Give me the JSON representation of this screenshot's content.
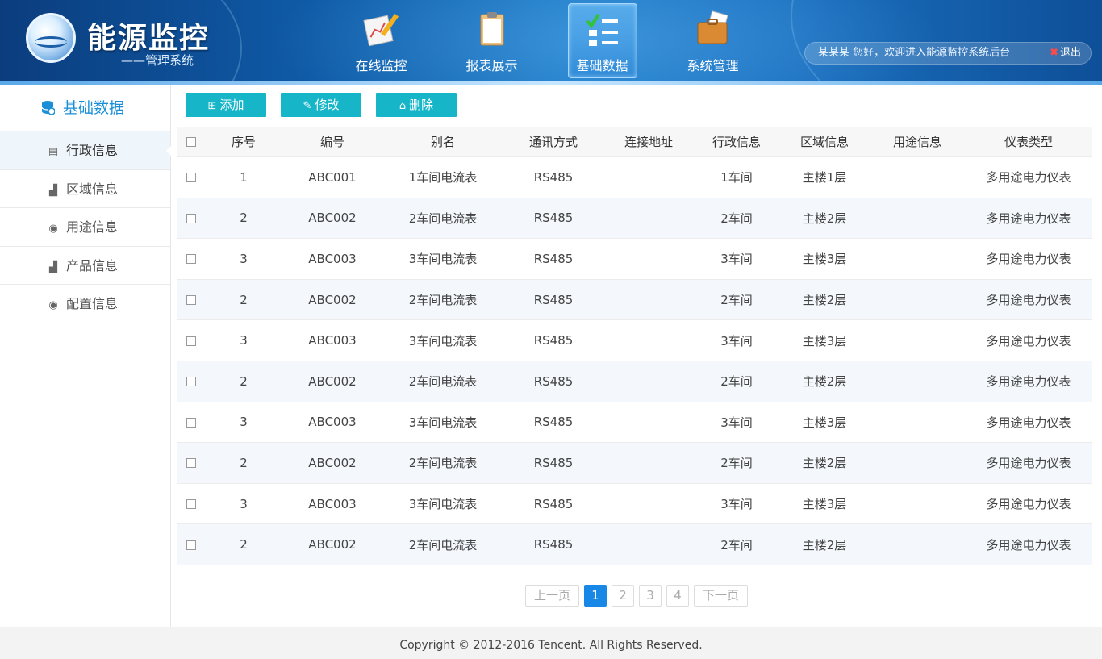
{
  "brand": {
    "title": "能源监控",
    "subtitle": "——管理系统"
  },
  "nav": {
    "items": [
      {
        "label": "在线监控"
      },
      {
        "label": "报表展示"
      },
      {
        "label": "基础数据",
        "active": true
      },
      {
        "label": "系统管理"
      }
    ]
  },
  "user": {
    "welcome": "某某某 您好，欢迎进入能源监控系统后台",
    "logout": "退出"
  },
  "sidebar": {
    "title": "基础数据",
    "items": [
      {
        "label": "行政信息",
        "icon": "list-icon",
        "active": true
      },
      {
        "label": "区域信息",
        "icon": "bar-chart-icon"
      },
      {
        "label": "用途信息",
        "icon": "eye-icon"
      },
      {
        "label": "产品信息",
        "icon": "bar-chart-icon"
      },
      {
        "label": "配置信息",
        "icon": "eye-icon"
      }
    ]
  },
  "toolbar": {
    "add_label": "添加",
    "edit_label": "修改",
    "delete_label": "删除"
  },
  "table": {
    "headers": [
      "序号",
      "编号",
      "别名",
      "通讯方式",
      "连接地址",
      "行政信息",
      "区域信息",
      "用途信息",
      "仪表类型"
    ],
    "rows": [
      [
        "1",
        "ABC001",
        "1车间电流表",
        "RS485",
        "",
        "1车间",
        "主楼1层",
        "",
        "多用途电力仪表"
      ],
      [
        "2",
        "ABC002",
        "2车间电流表",
        "RS485",
        "",
        "2车间",
        "主楼2层",
        "",
        "多用途电力仪表"
      ],
      [
        "3",
        "ABC003",
        "3车间电流表",
        "RS485",
        "",
        "3车间",
        "主楼3层",
        "",
        "多用途电力仪表"
      ],
      [
        "2",
        "ABC002",
        "2车间电流表",
        "RS485",
        "",
        "2车间",
        "主楼2层",
        "",
        "多用途电力仪表"
      ],
      [
        "3",
        "ABC003",
        "3车间电流表",
        "RS485",
        "",
        "3车间",
        "主楼3层",
        "",
        "多用途电力仪表"
      ],
      [
        "2",
        "ABC002",
        "2车间电流表",
        "RS485",
        "",
        "2车间",
        "主楼2层",
        "",
        "多用途电力仪表"
      ],
      [
        "3",
        "ABC003",
        "3车间电流表",
        "RS485",
        "",
        "3车间",
        "主楼3层",
        "",
        "多用途电力仪表"
      ],
      [
        "2",
        "ABC002",
        "2车间电流表",
        "RS485",
        "",
        "2车间",
        "主楼2层",
        "",
        "多用途电力仪表"
      ],
      [
        "3",
        "ABC003",
        "3车间电流表",
        "RS485",
        "",
        "3车间",
        "主楼3层",
        "",
        "多用途电力仪表"
      ],
      [
        "2",
        "ABC002",
        "2车间电流表",
        "RS485",
        "",
        "2车间",
        "主楼2层",
        "",
        "多用途电力仪表"
      ]
    ]
  },
  "pager": {
    "prev": "上一页",
    "pages": [
      "1",
      "2",
      "3",
      "4"
    ],
    "current": "1",
    "next": "下一页"
  },
  "footer": {
    "copyright": "Copyright © 2012-2016 Tencent. All Rights Reserved."
  },
  "colors": {
    "accent": "#16b5c8",
    "sidebar_title": "#1a8fd8",
    "pager_active": "#1788e6",
    "logout_x": "#ff4a4a"
  }
}
